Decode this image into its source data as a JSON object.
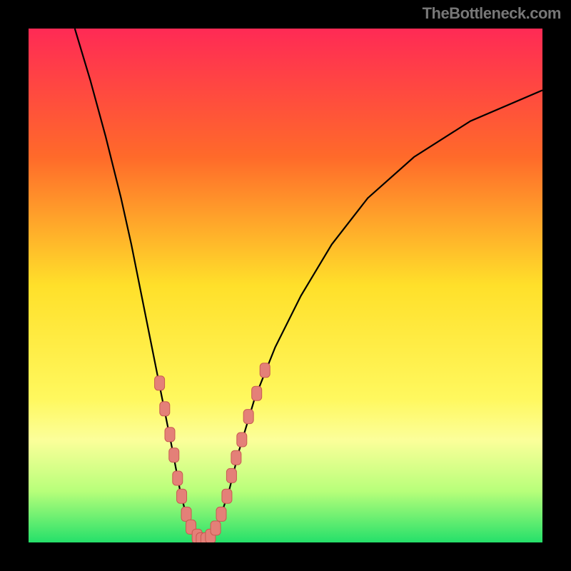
{
  "watermark": {
    "text": "TheBottleneck.com"
  },
  "chart_data": {
    "type": "line",
    "title": "",
    "xlabel": "",
    "ylabel": "",
    "xlim": [
      0,
      100
    ],
    "ylim": [
      0,
      100
    ],
    "gradient_stops": [
      {
        "offset": 0,
        "color": "#ff2a55"
      },
      {
        "offset": 25,
        "color": "#ff6a2a"
      },
      {
        "offset": 50,
        "color": "#ffe02a"
      },
      {
        "offset": 72,
        "color": "#fff85e"
      },
      {
        "offset": 80,
        "color": "#fcff9a"
      },
      {
        "offset": 90,
        "color": "#b8ff7a"
      },
      {
        "offset": 100,
        "color": "#25e06a"
      }
    ],
    "curve": [
      {
        "x": 9.0,
        "y": 100.0
      },
      {
        "x": 12.0,
        "y": 90.0
      },
      {
        "x": 15.0,
        "y": 79.0
      },
      {
        "x": 18.0,
        "y": 67.0
      },
      {
        "x": 20.0,
        "y": 58.0
      },
      {
        "x": 22.0,
        "y": 48.0
      },
      {
        "x": 24.0,
        "y": 38.0
      },
      {
        "x": 26.0,
        "y": 28.0
      },
      {
        "x": 28.0,
        "y": 18.0
      },
      {
        "x": 29.5,
        "y": 10.0
      },
      {
        "x": 31.0,
        "y": 4.0
      },
      {
        "x": 32.5,
        "y": 1.0
      },
      {
        "x": 34.0,
        "y": 0.2
      },
      {
        "x": 35.5,
        "y": 1.0
      },
      {
        "x": 37.0,
        "y": 4.0
      },
      {
        "x": 39.0,
        "y": 10.0
      },
      {
        "x": 41.0,
        "y": 18.0
      },
      {
        "x": 44.0,
        "y": 28.0
      },
      {
        "x": 48.0,
        "y": 38.0
      },
      {
        "x": 53.0,
        "y": 48.0
      },
      {
        "x": 59.0,
        "y": 58.0
      },
      {
        "x": 66.0,
        "y": 67.0
      },
      {
        "x": 75.0,
        "y": 75.0
      },
      {
        "x": 86.0,
        "y": 82.0
      },
      {
        "x": 100.0,
        "y": 88.0
      }
    ],
    "markers": [
      {
        "x": 25.5,
        "y": 31.0
      },
      {
        "x": 26.5,
        "y": 26.0
      },
      {
        "x": 27.5,
        "y": 21.0
      },
      {
        "x": 28.3,
        "y": 17.0
      },
      {
        "x": 29.0,
        "y": 12.5
      },
      {
        "x": 29.8,
        "y": 9.0
      },
      {
        "x": 30.7,
        "y": 5.5
      },
      {
        "x": 31.6,
        "y": 3.0
      },
      {
        "x": 32.8,
        "y": 1.2
      },
      {
        "x": 33.6,
        "y": 0.5
      },
      {
        "x": 34.5,
        "y": 0.5
      },
      {
        "x": 35.4,
        "y": 1.2
      },
      {
        "x": 36.4,
        "y": 2.8
      },
      {
        "x": 37.5,
        "y": 5.5
      },
      {
        "x": 38.6,
        "y": 9.0
      },
      {
        "x": 39.5,
        "y": 13.0
      },
      {
        "x": 40.4,
        "y": 16.5
      },
      {
        "x": 41.5,
        "y": 20.0
      },
      {
        "x": 42.8,
        "y": 24.5
      },
      {
        "x": 44.4,
        "y": 29.0
      },
      {
        "x": 46.0,
        "y": 33.5
      }
    ],
    "marker_style": {
      "fill": "#e48078",
      "stroke": "#c85a52",
      "rx": 5
    }
  }
}
